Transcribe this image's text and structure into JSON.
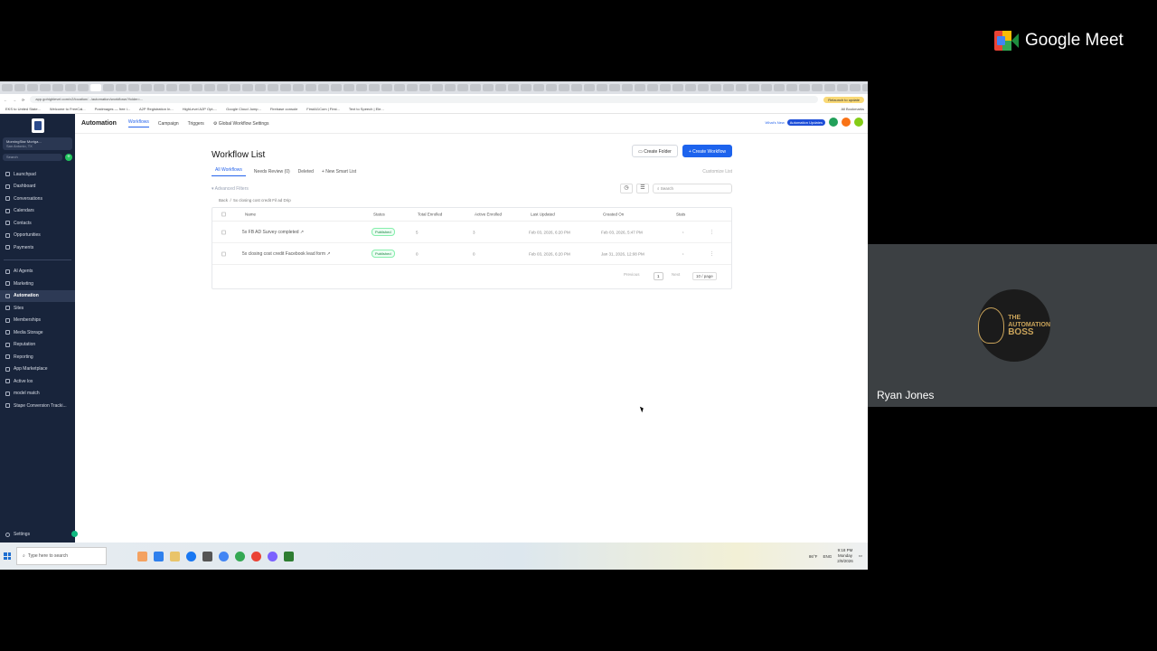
{
  "meet": {
    "brand": "Google Meet",
    "participant": {
      "name": "Ryan Jones",
      "avatar_line1": "THE",
      "avatar_line2": "AUTOMATION",
      "avatar_line3": "BOSS"
    }
  },
  "browser": {
    "url": "app.gohighlevel.com/v2/location/.../automation/workflows?folder=...",
    "relaunch": "Relaunch to update",
    "bookmarks": [
      "EKS to United State...",
      "Welcome to FreeCal...",
      "Postimages — free i...",
      "A2P Registration In...",
      "HighLevel A2P Opt-...",
      "Google Cloud Jump...",
      "Firebase console",
      "FirstAI1Com | First...",
      "Text to Speech | Ele..."
    ],
    "all_bookmarks": "All Bookmarks"
  },
  "sidebar": {
    "location_name": "MorningStar Mortga...",
    "location_sub": "San Antonio, TX",
    "search_placeholder": "Search",
    "search_shortcut": "ctrl K",
    "items_top": [
      "Launchpad",
      "Dashboard",
      "Conversations",
      "Calendars",
      "Contacts",
      "Opportunities",
      "Payments"
    ],
    "items_bottom": [
      "AI Agents",
      "Marketing",
      "Automation",
      "Sites",
      "Memberships",
      "Media Storage",
      "Reputation",
      "Reporting",
      "App Marketplace",
      "Active lox",
      "model match",
      "Stape Conversion Tracki..."
    ],
    "settings": "Settings"
  },
  "topnav": {
    "title": "Automation",
    "tabs": [
      "Workflows",
      "Campaign",
      "Triggers"
    ],
    "settings": "Global Workflow Settings",
    "whats_new": "What's New",
    "updates": "Automation Updates"
  },
  "main": {
    "title": "Workflow List",
    "create_folder": "Create Folder",
    "create_workflow": "Create Workflow",
    "tabs": [
      "All Workflows",
      "Needs Review (0)",
      "Deleted"
    ],
    "new_smart_list": "New Smart List",
    "customize_list": "Customize List",
    "advanced_filters": "Advanced Filters",
    "search_placeholder": "Search",
    "breadcrumb_back": "Back",
    "breadcrumb_folder": "5x closing cost credit Fil ad Drip",
    "columns": [
      "Name",
      "Status",
      "Total Enrolled",
      "Active Enrolled",
      "Last Updated",
      "Created On",
      "Stats"
    ],
    "rows": [
      {
        "name": "5x FB AD Survey completed",
        "status": "Published",
        "total": "5",
        "active": "3",
        "updated": "Feb 03, 2026, 6:20 PM",
        "created": "Feb 03, 2026, 5:47 PM"
      },
      {
        "name": "5x closing cost credit Facebook lead form",
        "status": "Published",
        "total": "0",
        "active": "0",
        "updated": "Feb 03, 2026, 6:20 PM",
        "created": "Jan 31, 2026, 12:08 PM"
      }
    ],
    "pager": {
      "previous": "Previous",
      "page": "1",
      "next": "Next",
      "per_page": "10 / page"
    }
  },
  "taskbar": {
    "search": "Type here to search",
    "weather": "86°F",
    "lang": "ENG",
    "time": "9:18 PM",
    "day": "Monday",
    "date": "2/9/2026"
  }
}
